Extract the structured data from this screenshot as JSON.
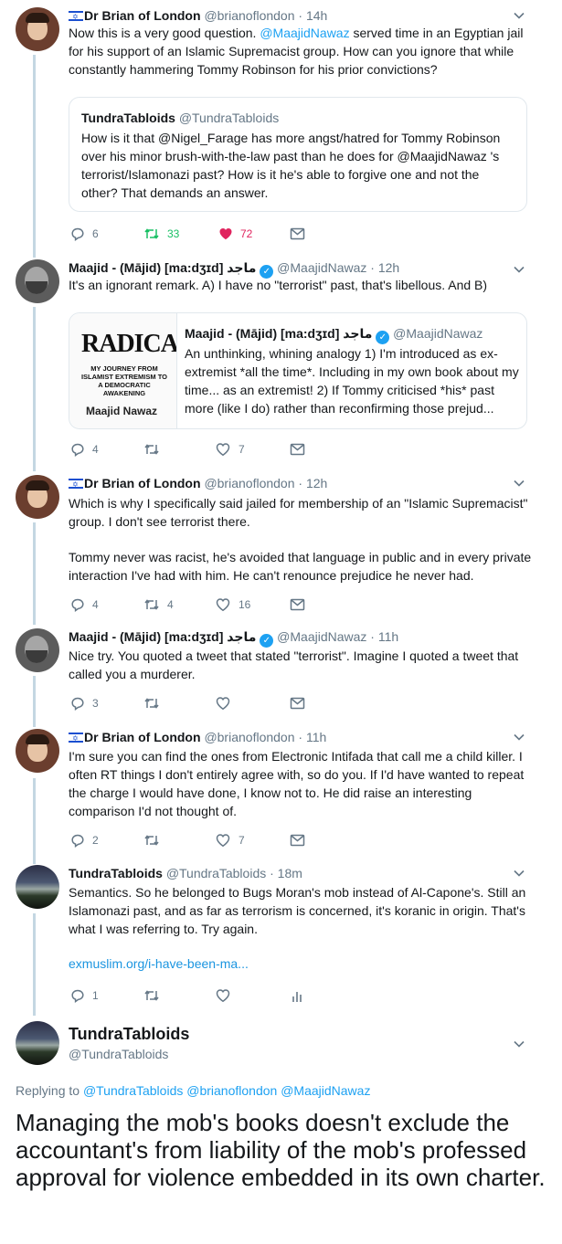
{
  "tweets": [
    {
      "name": "Dr Brian of London",
      "handle": "@brianoflondon",
      "time": "· 14h",
      "text_a": "Now this is a very good question. ",
      "text_mention": "@MaajidNawaz",
      "text_b": " served time in an Egyptian jail for his support of an Islamic Supremacist group. How can you ignore that while constantly hammering Tommy Robinson for his prior convictions?",
      "quote": {
        "name": "TundraTabloids",
        "handle": "@TundraTabloids",
        "text": "How is it that @Nigel_Farage has more angst/hatred for Tommy Robinson over his minor brush-with-the-law past than he does for @MaajidNawaz 's terrorist/Islamonazi past? How is it he's able to forgive one and not the other? That demands an answer."
      },
      "replies": "6",
      "retweets": "33",
      "likes": "72"
    },
    {
      "name": "Maajid - (Mājid) [ma:dʒɪd] ماجد",
      "handle": "@MaajidNawaz",
      "time": "· 12h",
      "text": "It's an ignorant remark. A) I have no \"terrorist\" past, that's libellous. And B)",
      "quote": {
        "name": "Maajid - (Mājid) [ma:dʒɪd] ماجد",
        "handle": "@MaajidNawaz",
        "text": "An unthinking, whining analogy 1) I'm introduced as ex-extremist *all the time*. Including in my own book about my time... as an extremist! 2) If Tommy criticised *his* past more (like I do) rather than reconfirming those prejud...",
        "book_title": "RADICAL",
        "book_sub": "MY JOURNEY FROM ISLAMIST EXTREMISM TO A DEMOCRATIC AWAKENING",
        "book_author": "Maajid Nawaz"
      },
      "replies": "4",
      "retweets": "",
      "likes": "7"
    },
    {
      "name": "Dr Brian of London",
      "handle": "@brianoflondon",
      "time": "· 12h",
      "text_p1": "Which is why I specifically said jailed for membership of an \"Islamic Supremacist\" group. I don't see terrorist there.",
      "text_p2": "Tommy never was racist, he's avoided that language in public and in every private interaction I've had with him. He can't renounce prejudice he never had.",
      "replies": "4",
      "retweets": "4",
      "likes": "16"
    },
    {
      "name": "Maajid - (Mājid) [ma:dʒɪd] ماجد",
      "handle": "@MaajidNawaz",
      "time": "· 11h",
      "text": "Nice try. You quoted a tweet that stated \"terrorist\". Imagine I quoted a tweet that called you a murderer.",
      "replies": "3",
      "retweets": "",
      "likes": ""
    },
    {
      "name": "Dr Brian of London",
      "handle": "@brianoflondon",
      "time": "· 11h",
      "text": "I'm sure you can find the ones from Electronic Intifada that call me a child killer. I often RT things I don't entirely agree with, so do you. If I'd have wanted to repeat the charge I would have done, I know not to. He did raise an interesting comparison I'd not thought of.",
      "replies": "2",
      "retweets": "",
      "likes": "7"
    },
    {
      "name": "TundraTabloids",
      "handle": "@TundraTabloids",
      "time": "· 18m",
      "text": "Semantics. So he belonged to Bugs Moran's mob instead of Al-Capone's. Still an Islamonazi past, and as far as terrorism is concerned, it's koranic in origin. That's what I was referring to. Try again.",
      "link": "exmuslim.org/i-have-been-ma...",
      "replies": "1",
      "retweets": "",
      "likes": ""
    }
  ],
  "focused": {
    "name": "TundraTabloids",
    "handle": "@TundraTabloids",
    "replying_prefix": "Replying to",
    "replying_to": "@TundraTabloids @brianoflondon @MaajidNawaz",
    "text": "Managing the mob's books doesn't exclude the accountant's from liability of the mob's professed approval for violence embedded in its own charter."
  },
  "colors": {
    "accent": "#1da1f2",
    "retweet_active": "#17bf63",
    "like_active": "#e0245e",
    "muted": "#657786",
    "thread_line": "#c4d7e2"
  },
  "icons": [
    "reply-icon",
    "retweet-icon",
    "heart-icon",
    "heart-filled-icon",
    "mail-icon",
    "analytics-icon",
    "chevron-down-icon",
    "verified-badge-icon",
    "israel-flag-icon"
  ]
}
